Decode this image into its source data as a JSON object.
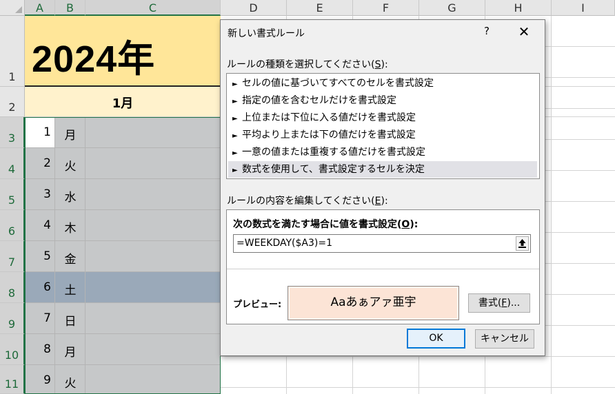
{
  "sheet": {
    "columns": [
      "A",
      "B",
      "C",
      "D",
      "E",
      "F",
      "G",
      "H",
      "I"
    ],
    "rows": [
      "1",
      "2",
      "3",
      "4",
      "5",
      "6",
      "7",
      "8",
      "9",
      "10",
      "11"
    ],
    "title": "2024年",
    "month": "1月",
    "days": [
      {
        "num": "1",
        "dow": "月"
      },
      {
        "num": "2",
        "dow": "火"
      },
      {
        "num": "3",
        "dow": "水"
      },
      {
        "num": "4",
        "dow": "木"
      },
      {
        "num": "5",
        "dow": "金"
      },
      {
        "num": "6",
        "dow": "土"
      },
      {
        "num": "7",
        "dow": "日"
      },
      {
        "num": "8",
        "dow": "月"
      },
      {
        "num": "9",
        "dow": "火"
      }
    ],
    "colors": {
      "title_fill": "#ffe699",
      "month_fill": "#fff2cc",
      "selection_fill": "#c6c8c9",
      "saturday_fill": "#9aa9b9",
      "accent": "#217346"
    }
  },
  "dialog": {
    "title": "新しい書式ルール",
    "help": "?",
    "close": "✕",
    "rule_type_label": "ルールの種類を選択してください(",
    "rule_type_key": "S",
    "rule_type_end": "):",
    "rule_types": [
      "セルの値に基づいてすべてのセルを書式設定",
      "指定の値を含むセルだけを書式設定",
      "上位または下位に入る値だけを書式設定",
      "平均より上または下の値だけを書式設定",
      "一意の値または重複する値だけを書式設定",
      "数式を使用して、書式設定するセルを決定"
    ],
    "rule_type_bullet": "►",
    "edit_label": "ルールの内容を編集してください(",
    "edit_key": "E",
    "edit_end": "):",
    "formula_label": "次の数式を満たす場合に値を書式設定(",
    "formula_key": "O",
    "formula_end": "):",
    "formula_value": "=WEEKDAY($A3)=1",
    "preview_label": "プレビュー:",
    "preview_text": "Aaあぁアァ亜宇",
    "format_button": "書式(",
    "format_key": "F",
    "format_end": ")...",
    "ok": "OK",
    "cancel": "キャンセル",
    "preview_fill": "#fce4d6"
  }
}
